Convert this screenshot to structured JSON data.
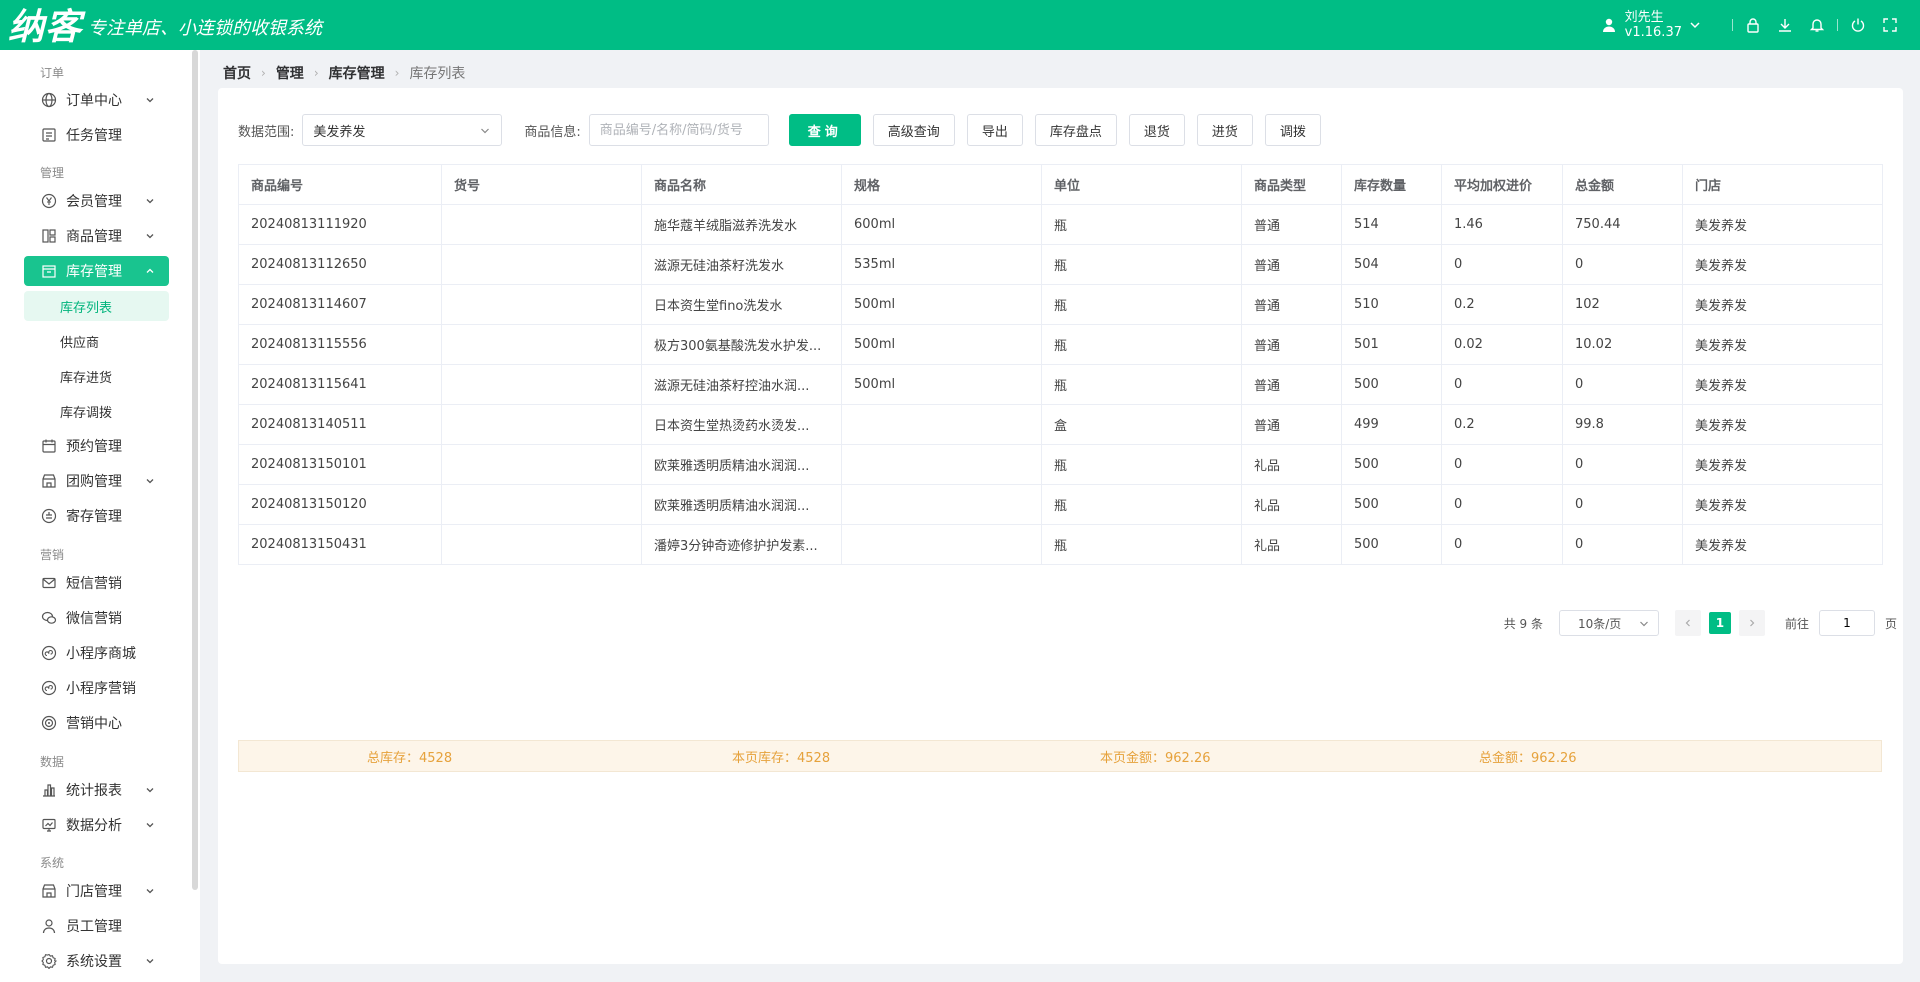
{
  "header": {
    "logo": "纳客",
    "slogan": "专注单店、小连锁的收银系统",
    "user_name": "刘先生",
    "version": "v1.16.37"
  },
  "sidebar": {
    "groups": {
      "order": "订单",
      "manage": "管理",
      "marketing": "营销",
      "data": "数据",
      "system": "系统"
    },
    "items": {
      "order_center": "订单中心",
      "task": "任务管理",
      "member": "会员管理",
      "product": "商品管理",
      "inventory": "库存管理",
      "inv_list": "库存列表",
      "supplier": "供应商",
      "inv_in": "库存进货",
      "inv_transfer": "库存调拨",
      "appointment": "预约管理",
      "groupbuy": "团购管理",
      "deposit": "寄存管理",
      "sms": "短信营销",
      "wechat": "微信营销",
      "mini_mall": "小程序商城",
      "mini_mkt": "小程序营销",
      "mkt_center": "营销中心",
      "stats": "统计报表",
      "analysis": "数据分析",
      "store": "门店管理",
      "staff": "员工管理",
      "settings": "系统设置"
    }
  },
  "breadcrumb": [
    "首页",
    "管理",
    "库存管理",
    "库存列表"
  ],
  "filter": {
    "range_label": "数据范围:",
    "range_value": "美发养发",
    "info_label": "商品信息:",
    "info_placeholder": "商品编号/名称/简码/货号",
    "buttons": {
      "query": "查询",
      "advanced": "高级查询",
      "export": "导出",
      "stocktake": "库存盘点",
      "return": "退货",
      "purchase": "进货",
      "transfer": "调拨"
    }
  },
  "table": {
    "headers": [
      "商品编号",
      "货号",
      "商品名称",
      "规格",
      "单位",
      "商品类型",
      "库存数量",
      "平均加权进价",
      "总金额",
      "门店"
    ],
    "rows": [
      [
        "20240813111920",
        "",
        "施华蔻羊绒脂滋养洗发水",
        "600ml",
        "瓶",
        "普通",
        "514",
        "1.46",
        "750.44",
        "美发养发"
      ],
      [
        "20240813112650",
        "",
        "滋源无硅油茶籽洗发水",
        "535ml",
        "瓶",
        "普通",
        "504",
        "0",
        "0",
        "美发养发"
      ],
      [
        "20240813114607",
        "",
        "日本资生堂fino洗发水",
        "500ml",
        "瓶",
        "普通",
        "510",
        "0.2",
        "102",
        "美发养发"
      ],
      [
        "20240813115556",
        "",
        "极方300氨基酸洗发水护发...",
        "500ml",
        "瓶",
        "普通",
        "501",
        "0.02",
        "10.02",
        "美发养发"
      ],
      [
        "20240813115641",
        "",
        "滋源无硅油茶籽控油水润...",
        "500ml",
        "瓶",
        "普通",
        "500",
        "0",
        "0",
        "美发养发"
      ],
      [
        "20240813140511",
        "",
        "日本资生堂热烫药水烫发...",
        "",
        "盒",
        "普通",
        "499",
        "0.2",
        "99.8",
        "美发养发"
      ],
      [
        "20240813150101",
        "",
        "欧莱雅透明质精油水润润...",
        "",
        "瓶",
        "礼品",
        "500",
        "0",
        "0",
        "美发养发"
      ],
      [
        "20240813150120",
        "",
        "欧莱雅透明质精油水润润...",
        "",
        "瓶",
        "礼品",
        "500",
        "0",
        "0",
        "美发养发"
      ],
      [
        "20240813150431",
        "",
        "潘婷3分钟奇迹修护护发素...",
        "",
        "瓶",
        "礼品",
        "500",
        "0",
        "0",
        "美发养发"
      ]
    ]
  },
  "summary": {
    "total_stock": "总库存：4528",
    "page_stock": "本页库存：4528",
    "page_amount": "本页金额：962.26",
    "total_amount": "总金额：962.26"
  },
  "pager": {
    "total": "共 9 条",
    "size": "10条/页",
    "current": "1",
    "goto_label": "前往",
    "goto_value": "1",
    "page_suffix": "页"
  },
  "colors": {
    "brand": "#00bd85",
    "summary_text": "#e6a23c"
  },
  "icons": [
    "user-icon",
    "lock-icon",
    "download-icon",
    "bell-icon",
    "power-icon",
    "fullscreen-icon"
  ]
}
